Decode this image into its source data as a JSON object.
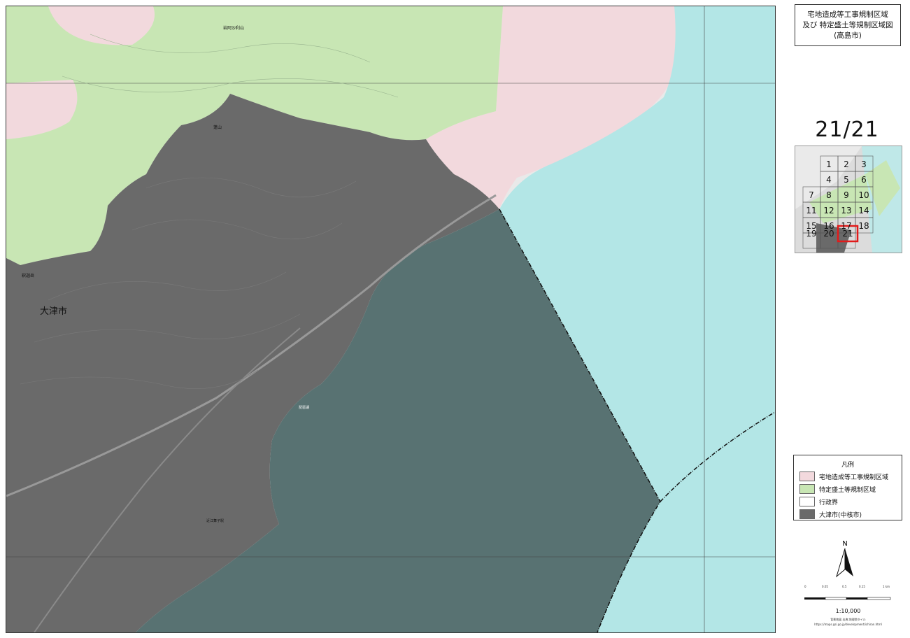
{
  "title": {
    "line1": "宅地造成等工事規制区域",
    "line2": "及び 特定盛土等規制区域図",
    "line3": "(高島市)"
  },
  "page_indicator": "21/21",
  "index_map": {
    "sheet_numbers": [
      "1",
      "2",
      "3",
      "4",
      "5",
      "6",
      "7",
      "8",
      "9",
      "10",
      "11",
      "12",
      "13",
      "14",
      "15",
      "16",
      "17",
      "18",
      "19",
      "20",
      "21"
    ],
    "current_sheet": "21"
  },
  "map_labels": {
    "city": "大津市",
    "mountain_top": "岩阿沙利山",
    "peak": "蓬山",
    "hill_west": "釈迦岳",
    "shore_label": "近江舞子駅",
    "lake_label": "琵琶湖"
  },
  "legend": {
    "title": "凡例",
    "items": [
      {
        "label": "宅地造成等工事規制区域",
        "color": "#f2d9dd"
      },
      {
        "label": "特定盛土等規制区域",
        "color": "#c8e6b4"
      },
      {
        "label": "行政界",
        "color": "#ffffff"
      },
      {
        "label": "大津市(中核市)",
        "color": "#6a6a6a"
      }
    ]
  },
  "north_arrow": "N",
  "scale": {
    "ticks": [
      "0",
      "0.05",
      "0.5",
      "0.15",
      "1 km"
    ],
    "ratio": "1:10,000"
  },
  "credit": {
    "line1": "背景地図 出典:地理院タイル",
    "line2": "https://maps.gsi.go.jp/development/ichiran.html"
  },
  "colors": {
    "residential_zone": "#f2d9dd",
    "fill_zone": "#c8e6b4",
    "otsu_city": "#6a6a6a",
    "lake": "#b3e6e6",
    "lake_otsu": "#587272",
    "highlight": "#e11b1b"
  }
}
